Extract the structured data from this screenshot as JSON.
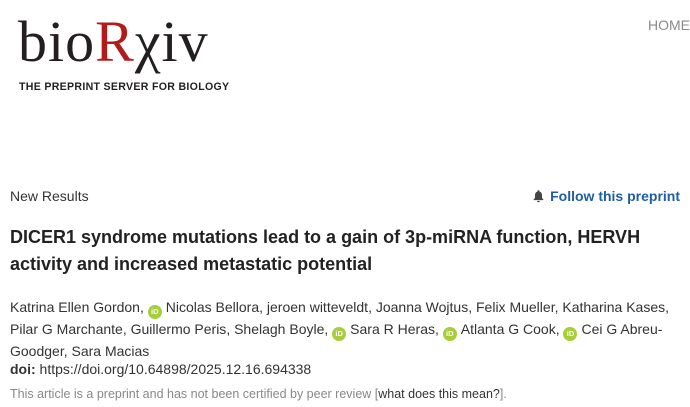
{
  "header": {
    "logo": {
      "prefix": "bio",
      "r": "R",
      "suffix": "χiv",
      "accent_color": "#b31b1b"
    },
    "tagline": "THE PREPRINT SERVER FOR BIOLOGY",
    "nav": {
      "home": "HOME"
    }
  },
  "article": {
    "type": "New Results",
    "follow_label": "Follow this preprint",
    "title": "DICER1 syndrome mutations lead to a gain of 3p-miRNA function, HERVH activity and increased metastatic potential",
    "orcid_icon_text": "iD",
    "orcid_color": "#a6ce39",
    "authors": [
      {
        "name": "Katrina Ellen Gordon",
        "orcid": false
      },
      {
        "name": "Nicolas Bellora",
        "orcid": true
      },
      {
        "name": "jeroen witteveldt",
        "orcid": false
      },
      {
        "name": "Joanna Wojtus",
        "orcid": false
      },
      {
        "name": "Felix Mueller",
        "orcid": false
      },
      {
        "name": "Katharina Kases",
        "orcid": false
      },
      {
        "name": "Pilar G Marchante",
        "orcid": false
      },
      {
        "name": "Guillermo Peris",
        "orcid": false
      },
      {
        "name": "Shelagh Boyle",
        "orcid": false
      },
      {
        "name": "Sara R Heras",
        "orcid": true
      },
      {
        "name": "Atlanta G Cook",
        "orcid": true
      },
      {
        "name": "Cei G Abreu-Goodger",
        "orcid": true
      },
      {
        "name": "Sara Macias",
        "orcid": false
      }
    ],
    "doi_label": "doi:",
    "doi_value": "https://doi.org/10.64898/2025.12.16.694338",
    "disclaimer_prefix": "This article is a preprint and has not been certified by peer review [",
    "disclaimer_link": "what does this mean?",
    "disclaimer_suffix": "]."
  }
}
